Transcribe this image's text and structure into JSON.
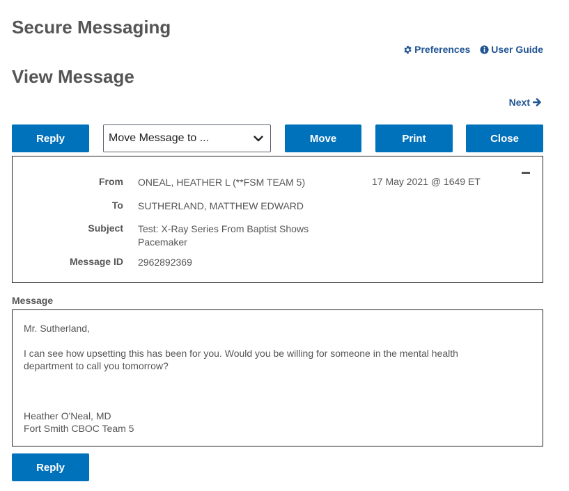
{
  "app_title": "Secure Messaging",
  "page_title": "View Message",
  "top_links": {
    "preferences": "Preferences",
    "user_guide": "User Guide"
  },
  "nav": {
    "next": "Next"
  },
  "toolbar": {
    "reply": "Reply",
    "move_select": "Move Message to ...",
    "move": "Move",
    "print": "Print",
    "close": "Close"
  },
  "header": {
    "from_label": "From",
    "from_value": "ONEAL, HEATHER L (**FSM TEAM 5)",
    "date": "17 May 2021 @ 1649 ET",
    "to_label": "To",
    "to_value": "SUTHERLAND, MATTHEW EDWARD",
    "subject_label": "Subject",
    "subject_line1": "Test: X-Ray Series From Baptist Shows",
    "subject_line2": "Pacemaker",
    "message_id_label": "Message ID",
    "message_id_value": "2962892369"
  },
  "message": {
    "label": "Message",
    "greeting": "Mr. Sutherland,",
    "body_line1": "I can see how upsetting this has been for you. Would you be willing for someone in the mental health",
    "body_line2": "department to call you tomorrow?",
    "signature_name": "Heather O'Neal, MD",
    "signature_team": "Fort Smith CBOC Team 5"
  },
  "bottom": {
    "reply": "Reply"
  },
  "colors": {
    "accent": "#0071bb",
    "link": "#205493",
    "text": "#555555"
  }
}
